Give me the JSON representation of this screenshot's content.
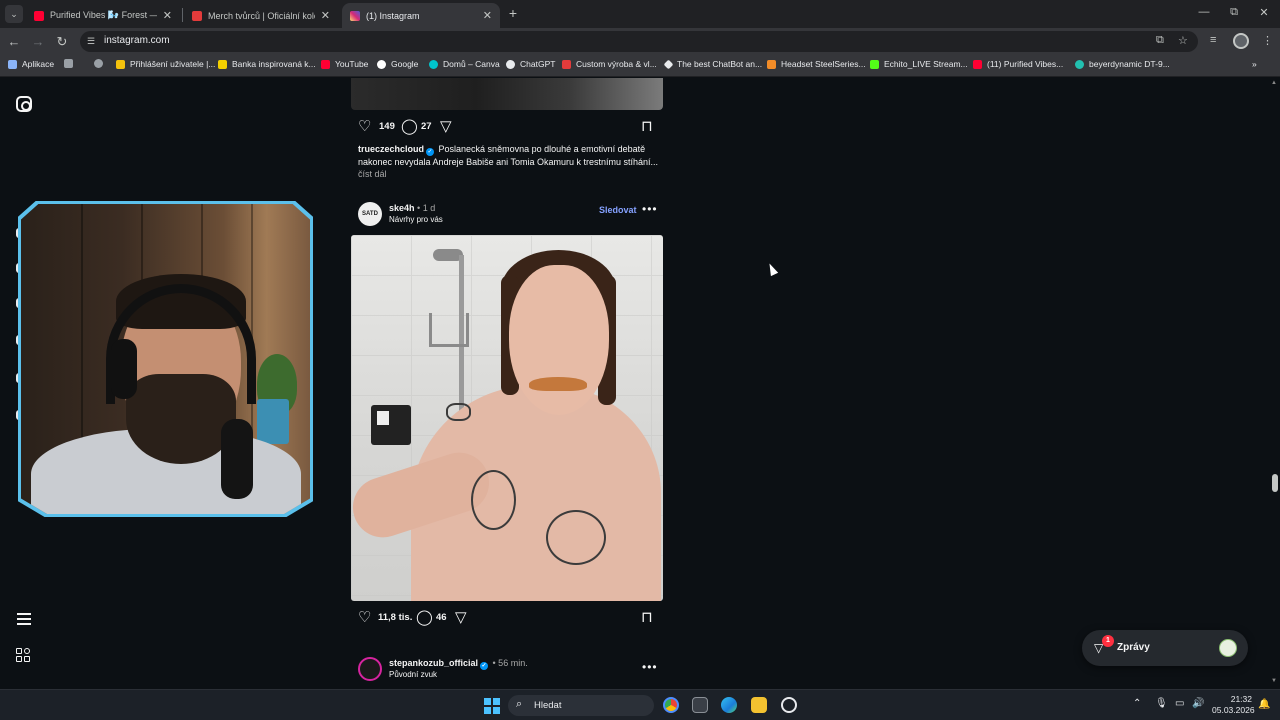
{
  "browser": {
    "tabs": [
      {
        "label": "Purified Vibes 🌬️ Forest — Chi",
        "favicon_color": "#ff0033",
        "active": false
      },
      {
        "label": "Merch tvůrců | Oficiální kolekce",
        "favicon_color": "#e33b3b",
        "active": false
      },
      {
        "label": "(1) Instagram",
        "favicon_color": "#d6249f",
        "active": true
      }
    ],
    "new_tab": "+",
    "window_controls": {
      "minimize": "—",
      "maximize": "⧉",
      "close": "✕"
    },
    "url": "instagram.com",
    "bookmarks": [
      {
        "label": "Aplikace",
        "favicon_color": "#8ab4f8"
      },
      {
        "label": "",
        "favicon_color": "#9aa0a6"
      },
      {
        "label": "",
        "favicon_color": "#9aa0a6"
      },
      {
        "label": "Přihlášení uživatele |...",
        "favicon_color": "#f4c20d"
      },
      {
        "label": "Banka inspirovaná k...",
        "favicon_color": "#f4d000"
      },
      {
        "label": "YouTube",
        "favicon_color": "#ff0033"
      },
      {
        "label": "Google",
        "favicon_color": "#ffffff"
      },
      {
        "label": "Domů – Canva",
        "favicon_color": "#00c4cc"
      },
      {
        "label": "ChatGPT",
        "favicon_color": "#e8eaed"
      },
      {
        "label": "Custom výroba & vl...",
        "favicon_color": "#e33b3b"
      },
      {
        "label": "The best ChatBot an...",
        "favicon_color": "#e8eaed"
      },
      {
        "label": "Headset SteelSeries...",
        "favicon_color": "#f28c28"
      },
      {
        "label": "Echito_LIVE Stream...",
        "favicon_color": "#53fc18"
      },
      {
        "label": "(11) Purified Vibes...",
        "favicon_color": "#ff0033"
      },
      {
        "label": "beyerdynamic DT-9...",
        "favicon_color": "#22c0b0"
      }
    ],
    "bookmarks_more": "»"
  },
  "feed": {
    "post1": {
      "likes": "149",
      "comments": "27",
      "caption_user": "trueczechcloud",
      "caption_text": "Poslanecká sněmovna po dlouhé a emotivní debatě nakonec nevydala Andreje Babiše ani Tomia Okamuru k trestnímu stíhání...",
      "read_more": "číst dál"
    },
    "post2": {
      "username": "ske4h",
      "avatar_text": "SATD",
      "time": "• 1 d",
      "subtitle": "Návrhy pro vás",
      "follow_label": "Sledovat",
      "more": "•••",
      "likes": "11,8 tis.",
      "comments": "46"
    },
    "post3": {
      "username": "stepankozub_official",
      "time": "• 56 min.",
      "subtitle": "Původní zvuk",
      "more": "•••"
    }
  },
  "messages": {
    "label": "Zprávy",
    "badge": "1"
  },
  "taskbar": {
    "search_placeholder": "Hledat",
    "time": "21:32",
    "date": "05.03.2026"
  }
}
